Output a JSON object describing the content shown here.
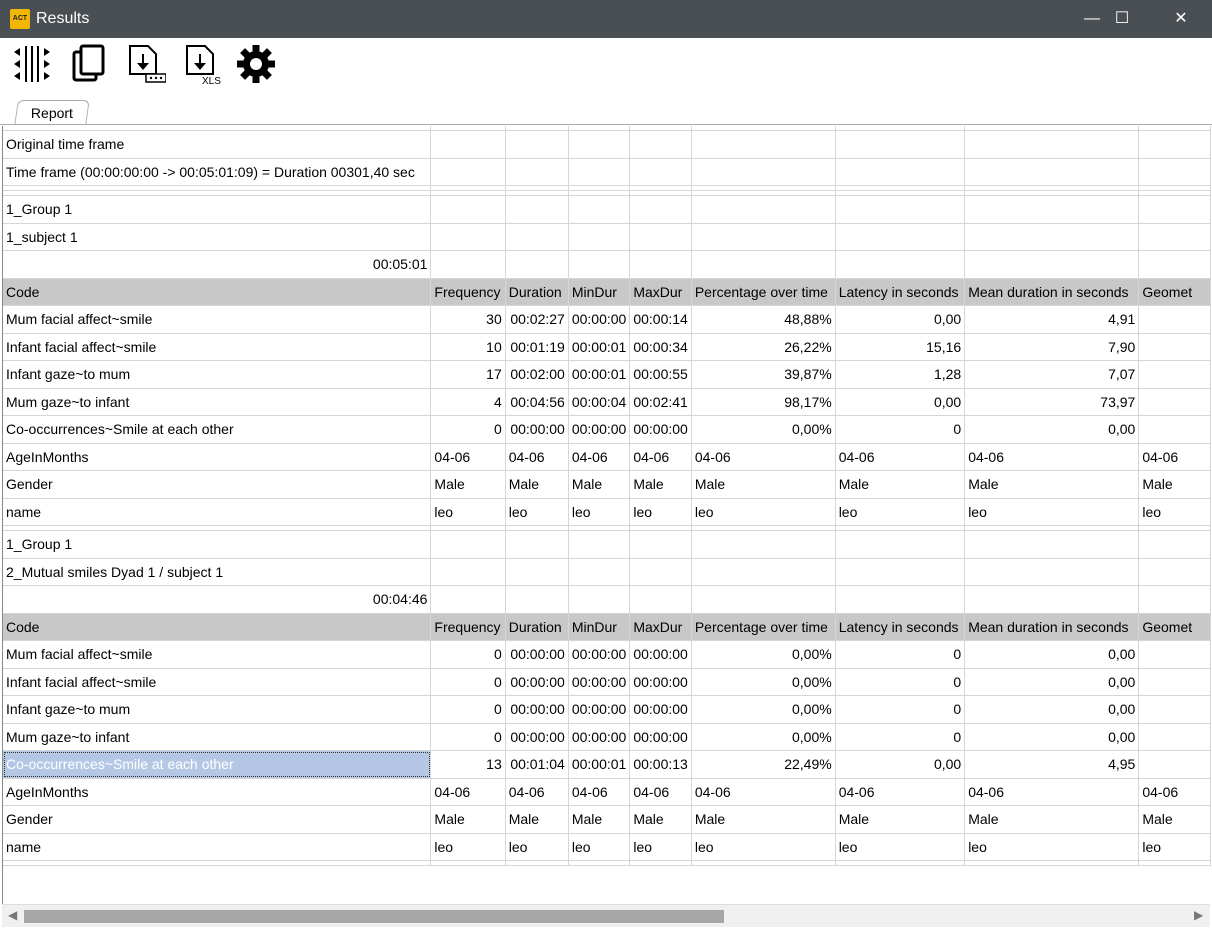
{
  "window": {
    "title": "Results",
    "icon_text": "ACT",
    "minimize": "—",
    "maximize": "☐",
    "close": "✕"
  },
  "toolbar": {
    "icons": [
      "columns-icon",
      "copy-icon",
      "export-icon",
      "export-xls-icon",
      "settings-icon"
    ],
    "xls_label": "XLS"
  },
  "tabs": [
    {
      "label": "Report"
    }
  ],
  "columns": [
    "Code",
    "Frequency",
    "Duration",
    "MinDur",
    "MaxDur",
    "Percentage over time",
    "Latency in seconds",
    "Mean duration in seconds",
    "Geomet"
  ],
  "report": {
    "time_frame_title": "Original time frame",
    "time_frame": "Time frame  (00:00:00:00 -> 00:05:01:09) = Duration 00301,40 sec",
    "blocks": [
      {
        "group": "1_Group 1",
        "subject": "1_subject 1",
        "duration": "00:05:01",
        "rows": [
          [
            "Mum facial affect~smile",
            "30",
            "00:02:27",
            "00:00:00",
            "00:00:14",
            "48,88%",
            "0,00",
            "4,91",
            ""
          ],
          [
            "Infant facial affect~smile",
            "10",
            "00:01:19",
            "00:00:01",
            "00:00:34",
            "26,22%",
            "15,16",
            "7,90",
            ""
          ],
          [
            "Infant gaze~to mum",
            "17",
            "00:02:00",
            "00:00:01",
            "00:00:55",
            "39,87%",
            "1,28",
            "7,07",
            ""
          ],
          [
            "Mum gaze~to infant",
            "4",
            "00:04:56",
            "00:00:04",
            "00:02:41",
            "98,17%",
            "0,00",
            "73,97",
            ""
          ],
          [
            "Co-occurrences~Smile at each other",
            "0",
            "00:00:00",
            "00:00:00",
            "00:00:00",
            "0,00%",
            "0",
            "0,00",
            ""
          ]
        ],
        "attributes": [
          [
            "AgeInMonths",
            "04-06",
            "04-06",
            "04-06",
            "04-06",
            "04-06",
            "04-06",
            "04-06",
            "04-06"
          ],
          [
            "Gender",
            "Male",
            "Male",
            "Male",
            "Male",
            "Male",
            "Male",
            "Male",
            "Male"
          ],
          [
            "name",
            "leo",
            "leo",
            "leo",
            "leo",
            "leo",
            "leo",
            "leo",
            "leo"
          ]
        ]
      },
      {
        "group": "1_Group 1",
        "subject": "2_Mutual smiles Dyad 1 / subject 1",
        "duration": "00:04:46",
        "rows": [
          [
            "Mum facial affect~smile",
            "0",
            "00:00:00",
            "00:00:00",
            "00:00:00",
            "0,00%",
            "0",
            "0,00",
            ""
          ],
          [
            "Infant facial affect~smile",
            "0",
            "00:00:00",
            "00:00:00",
            "00:00:00",
            "0,00%",
            "0",
            "0,00",
            ""
          ],
          [
            "Infant gaze~to mum",
            "0",
            "00:00:00",
            "00:00:00",
            "00:00:00",
            "0,00%",
            "0",
            "0,00",
            ""
          ],
          [
            "Mum gaze~to infant",
            "0",
            "00:00:00",
            "00:00:00",
            "00:00:00",
            "0,00%",
            "0",
            "0,00",
            ""
          ],
          [
            "Co-occurrences~Smile at each other",
            "13",
            "00:01:04",
            "00:00:01",
            "00:00:13",
            "22,49%",
            "0,00",
            "4,95",
            ""
          ]
        ],
        "attributes": [
          [
            "AgeInMonths",
            "04-06",
            "04-06",
            "04-06",
            "04-06",
            "04-06",
            "04-06",
            "04-06",
            "04-06"
          ],
          [
            "Gender",
            "Male",
            "Male",
            "Male",
            "Male",
            "Male",
            "Male",
            "Male",
            "Male"
          ],
          [
            "name",
            "leo",
            "leo",
            "leo",
            "leo",
            "leo",
            "leo",
            "leo",
            "leo"
          ]
        ]
      }
    ],
    "selected": {
      "block": 1,
      "row": 4,
      "col": 0
    }
  }
}
